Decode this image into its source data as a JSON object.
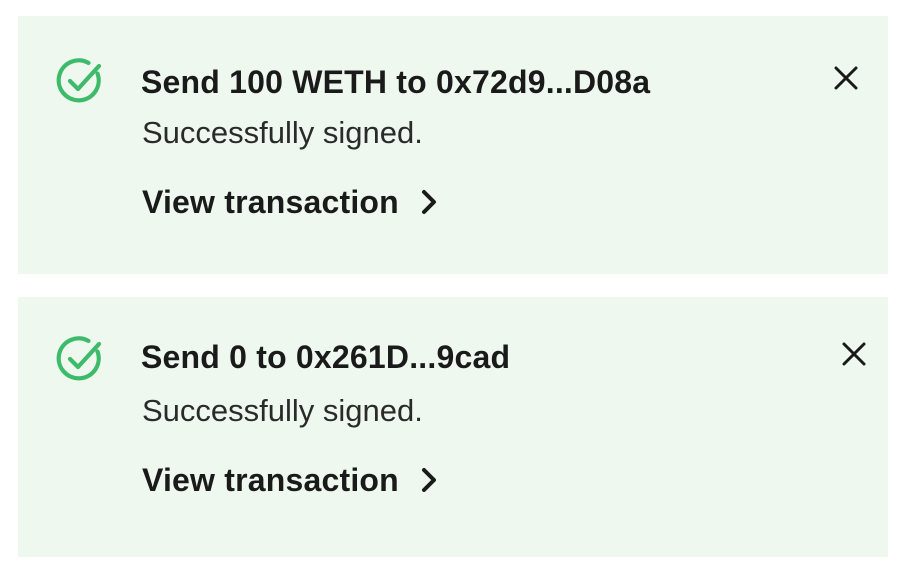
{
  "colors": {
    "toast_background": "#eef8ef",
    "success_green": "#3dba6a",
    "text_primary": "#1a1a1a"
  },
  "notifications": [
    {
      "icon": "check-circle-icon",
      "title": "Send 100 WETH to 0x72d9...D08a",
      "message": "Successfully signed.",
      "link_label": "View transaction",
      "link_icon": "chevron-right-icon",
      "close_icon": "close-icon"
    },
    {
      "icon": "check-circle-icon",
      "title": "Send 0 to 0x261D...9cad",
      "message": "Successfully signed.",
      "link_label": "View transaction",
      "link_icon": "chevron-right-icon",
      "close_icon": "close-icon"
    }
  ]
}
